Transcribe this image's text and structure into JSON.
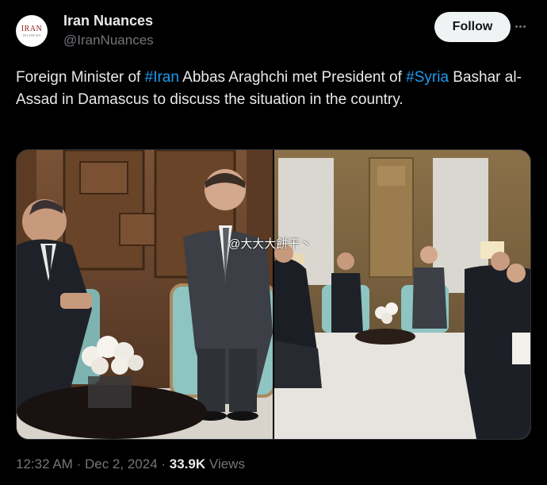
{
  "account": {
    "name": "Iran Nuances",
    "handle": "@IranNuances",
    "avatar_logo": "IRAN",
    "avatar_logo_sub": "NUANCES"
  },
  "actions": {
    "follow_label": "Follow",
    "more_icon": "more-dots-icon"
  },
  "tweet": {
    "text_1": "Foreign Minister of ",
    "hashtag_1": "#Iran",
    "text_2": " Abbas Araghchi met President of ",
    "hashtag_2": "#Syria",
    "text_3": " Bashar al-Assad in Damascus to discuss the situation in the country.",
    "hashtag_color": "#1d9bf0"
  },
  "media": {
    "watermark": "@大大大餅干丶"
  },
  "meta": {
    "time": "12:32 AM",
    "separator": "·",
    "date": "Dec 2, 2024",
    "views_count": "33.9K",
    "views_label": "Views"
  }
}
